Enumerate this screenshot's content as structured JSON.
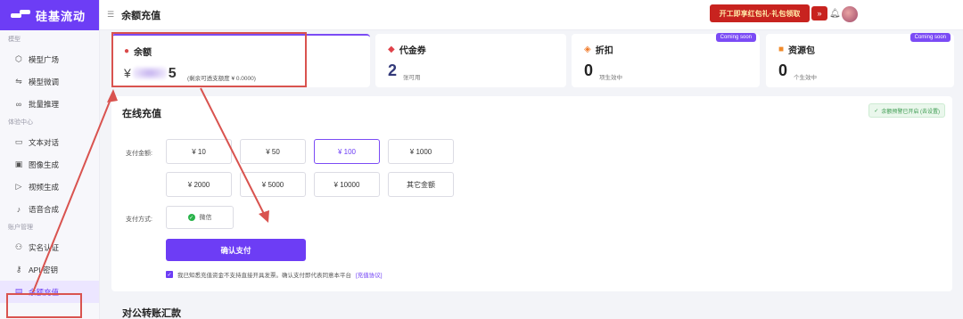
{
  "app": {
    "logo_text": "硅基流动"
  },
  "sidebar": {
    "sections": [
      {
        "label": "模型",
        "items": [
          {
            "label": "模型广场",
            "icon": "cube-icon"
          },
          {
            "label": "模型微调",
            "icon": "tune-icon"
          },
          {
            "label": "批量推理",
            "icon": "link-icon"
          }
        ]
      },
      {
        "label": "体验中心",
        "items": [
          {
            "label": "文本对话",
            "icon": "chat-icon"
          },
          {
            "label": "图像生成",
            "icon": "image-icon"
          },
          {
            "label": "视频生成",
            "icon": "video-icon"
          },
          {
            "label": "语音合成",
            "icon": "mic-icon"
          }
        ]
      },
      {
        "label": "账户管理",
        "items": [
          {
            "label": "实名认证",
            "icon": "user-verify-icon"
          },
          {
            "label": "API 密钥",
            "icon": "key-icon"
          },
          {
            "label": "余额充值",
            "icon": "wallet-icon",
            "active": true
          }
        ]
      }
    ]
  },
  "header": {
    "title": "余额充值",
    "promo_text": "开工即享红包礼·礼包领取",
    "promo_arrow": "»"
  },
  "cards": {
    "balance": {
      "title": "余额",
      "prefix": "¥",
      "suffix": "5",
      "note": "(剩余可透支额度 ¥ 0.0000)"
    },
    "voucher": {
      "title": "代金券",
      "value": "2",
      "sub": "张可用"
    },
    "discount": {
      "title": "折扣",
      "value": "0",
      "sub": "项生效中",
      "badge": "Coming soon"
    },
    "package": {
      "title": "资源包",
      "value": "0",
      "sub": "个生效中",
      "badge": "Coming soon"
    }
  },
  "recharge": {
    "title": "在线充值",
    "notice": "余额预警已开启 (去设置)",
    "amount_label": "支付金额:",
    "amounts": [
      "¥ 10",
      "¥ 50",
      "¥ 100",
      "¥ 1000",
      "¥ 2000",
      "¥ 5000",
      "¥ 10000",
      "其它金额"
    ],
    "selected_amount": "¥ 100",
    "method_label": "支付方式:",
    "method": "微信",
    "confirm_label": "确认支付",
    "agreement_text": "我已知悉充值资金不支持直接开具发票。确认支付即代表同意本平台",
    "agreement_link": "[充值协议]"
  },
  "transfer": {
    "title": "对公转账汇款"
  },
  "colors": {
    "accent": "#6d3df5",
    "highlight": "#d9534f",
    "promo": "#c8231f"
  }
}
